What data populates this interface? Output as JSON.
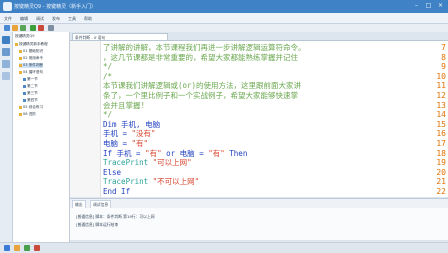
{
  "window": {
    "title": "按键精灵Q9 - 按键精灵（新手入门）",
    "minimize_label": "–",
    "maximize_label": "□",
    "close_label": "×"
  },
  "menubar": [
    "文件",
    "编辑",
    "调试",
    "发布",
    "工具",
    "帮助"
  ],
  "tree": {
    "header": "按键精灵Q9",
    "items": [
      {
        "label": "按键精灵新手教程",
        "indent": 0,
        "selected": false
      },
      {
        "label": "01 基础知识",
        "indent": 1,
        "selected": false
      },
      {
        "label": "02 常用命令",
        "indent": 1,
        "selected": false
      },
      {
        "label": "03 条件判断",
        "indent": 1,
        "selected": true
      },
      {
        "label": "04 循环语句",
        "indent": 1,
        "selected": false
      },
      {
        "label": "第一节",
        "indent": 2,
        "selected": false
      },
      {
        "label": "第二节",
        "indent": 2,
        "selected": false
      },
      {
        "label": "第三节",
        "indent": 2,
        "selected": false
      },
      {
        "label": "第四节",
        "indent": 2,
        "selected": false
      },
      {
        "label": "05 综合练习",
        "indent": 1,
        "selected": false
      },
      {
        "label": "06 进阶",
        "indent": 1,
        "selected": false
      }
    ]
  },
  "editor": {
    "tab_label": "条件判断 - If 语句",
    "lines": [
      {
        "num": "7",
        "parts": [
          {
            "t": "了讲解的讲解，本节课程我们再进一步讲解逻辑运算符命令。",
            "c": "c-comment"
          }
        ]
      },
      {
        "num": "8",
        "parts": [
          {
            "t": "，这几节课都是非常重要的，希望大家都能熟练掌握并记住",
            "c": "c-comment"
          }
        ]
      },
      {
        "num": "9",
        "parts": [
          {
            "t": "*/",
            "c": "c-comment"
          }
        ]
      },
      {
        "num": "10",
        "parts": [
          {
            "t": "/*",
            "c": "c-comment"
          }
        ]
      },
      {
        "num": "11",
        "parts": [
          {
            "t": "本节课我们讲解逻辑或(or)的使用方法，这里跟前面大家讲",
            "c": "c-comment"
          }
        ]
      },
      {
        "num": "12",
        "parts": [
          {
            "t": "条了，一个里比例子和一个实战例子，希望大家能够快速掌",
            "c": "c-comment"
          }
        ]
      },
      {
        "num": "13",
        "parts": [
          {
            "t": "会并且掌握!",
            "c": "c-comment"
          }
        ]
      },
      {
        "num": "14",
        "parts": [
          {
            "t": "*/",
            "c": "c-comment"
          }
        ]
      },
      {
        "num": "15",
        "parts": [
          {
            "t": "Dim 手机, 电脑",
            "c": "c-kw"
          }
        ]
      },
      {
        "num": "16",
        "parts": [
          {
            "t": "手机 = ",
            "c": "c-plain"
          },
          {
            "t": "\"没有\"",
            "c": "c-str"
          }
        ]
      },
      {
        "num": "17",
        "parts": [
          {
            "t": "电脑 = ",
            "c": "c-plain"
          },
          {
            "t": "\"有\"",
            "c": "c-str"
          }
        ]
      },
      {
        "num": "18",
        "parts": [
          {
            "t": "If 手机 = ",
            "c": "c-kw"
          },
          {
            "t": "\"有\"",
            "c": "c-str"
          },
          {
            "t": " or 电脑 = ",
            "c": "c-kw"
          },
          {
            "t": "\"有\"",
            "c": "c-str"
          },
          {
            "t": " Then",
            "c": "c-kw"
          }
        ]
      },
      {
        "num": "19",
        "parts": [
          {
            "t": "    TracePrint ",
            "c": "c-fn"
          },
          {
            "t": "\"可以上网\"",
            "c": "c-str"
          }
        ]
      },
      {
        "num": "20",
        "parts": [
          {
            "t": "    Else",
            "c": "c-kw"
          }
        ]
      },
      {
        "num": "21",
        "parts": [
          {
            "t": "    TracePrint ",
            "c": "c-fn"
          },
          {
            "t": "\"不可以上网\"",
            "c": "c-str"
          }
        ]
      },
      {
        "num": "22",
        "parts": [
          {
            "t": "End If",
            "c": "c-kw"
          }
        ]
      }
    ]
  },
  "output": {
    "tabs": [
      "输出",
      "调试信息"
    ],
    "lines": [
      "[普通信息] 脚本：条件判断 第19行：可以上网",
      "[普通信息] 脚本运行结束"
    ]
  }
}
